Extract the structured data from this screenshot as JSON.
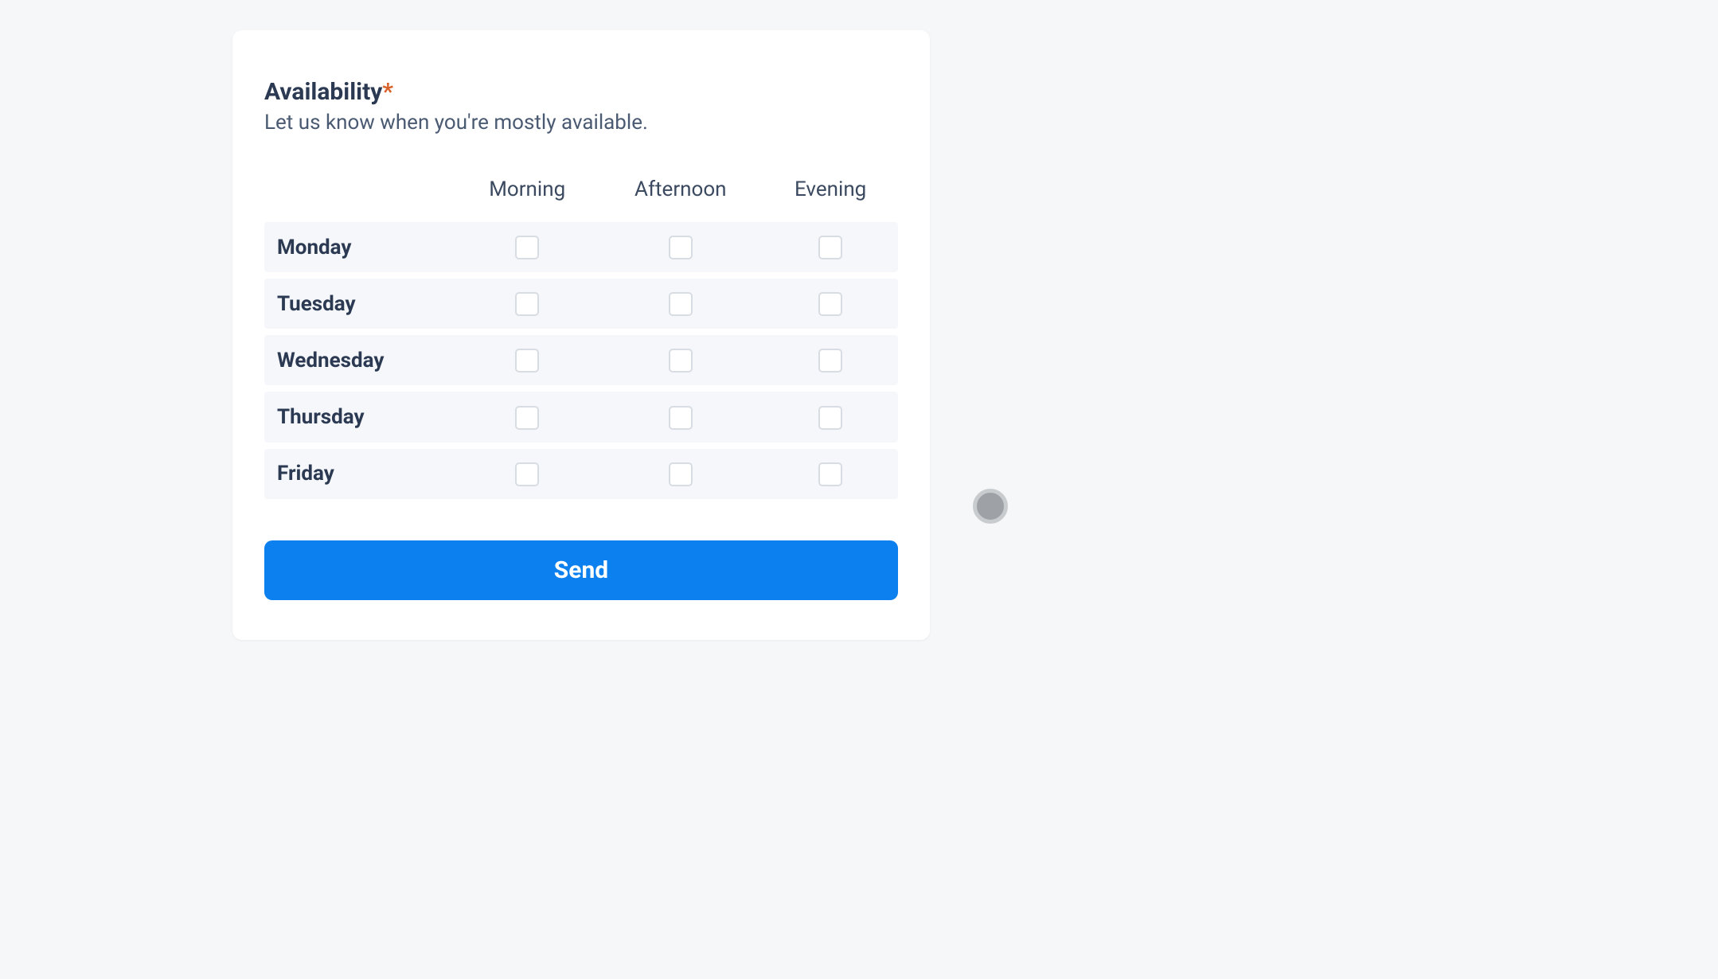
{
  "form": {
    "title": "Availability",
    "required_marker": "*",
    "subtitle": "Let us know when you're mostly available.",
    "columns": [
      "Morning",
      "Afternoon",
      "Evening"
    ],
    "rows": [
      "Monday",
      "Tuesday",
      "Wednesday",
      "Thursday",
      "Friday"
    ],
    "values": {
      "Monday": {
        "Morning": false,
        "Afternoon": false,
        "Evening": false
      },
      "Tuesday": {
        "Morning": false,
        "Afternoon": false,
        "Evening": false
      },
      "Wednesday": {
        "Morning": false,
        "Afternoon": false,
        "Evening": false
      },
      "Thursday": {
        "Morning": false,
        "Afternoon": false,
        "Evening": false
      },
      "Friday": {
        "Morning": false,
        "Afternoon": false,
        "Evening": false
      }
    },
    "submit_label": "Send"
  },
  "colors": {
    "accent": "#0b80ee",
    "required": "#d9622a"
  }
}
